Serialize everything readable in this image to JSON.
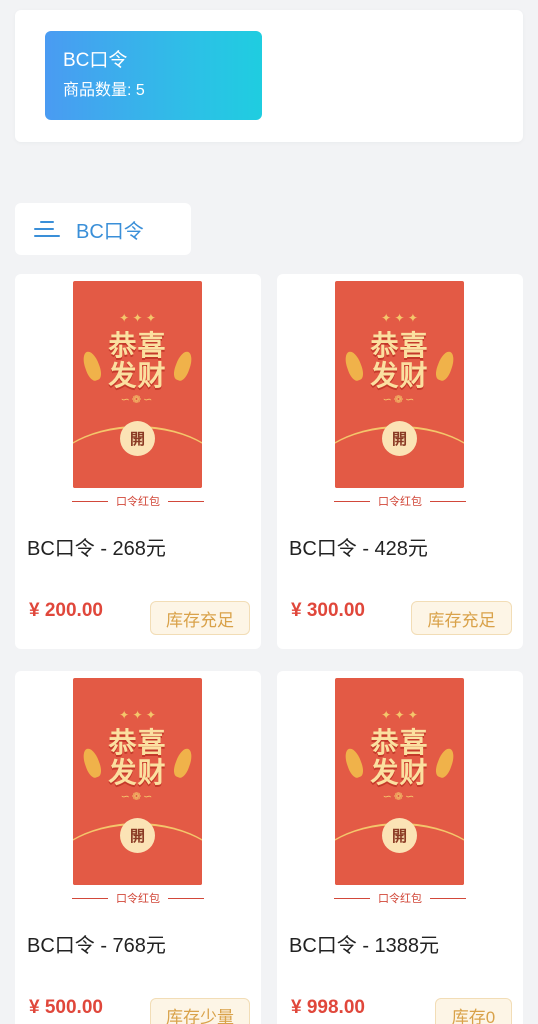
{
  "category": {
    "title": "BC口令",
    "count_text": "商品数量: 5"
  },
  "section": {
    "label": "BC口令"
  },
  "envelope": {
    "blessing_line1": "恭喜",
    "blessing_line2": "发财",
    "seal": "開",
    "caption": "口令红包"
  },
  "products": [
    {
      "name": "BC口令 - 268元",
      "price": "¥ 200.00",
      "stock": "库存充足"
    },
    {
      "name": "BC口令 - 428元",
      "price": "¥ 300.00",
      "stock": "库存充足"
    },
    {
      "name": "BC口令 - 768元",
      "price": "¥ 500.00",
      "stock": "库存少量"
    },
    {
      "name": "BC口令 - 1388元",
      "price": "¥ 998.00",
      "stock": "库存0"
    }
  ],
  "colors": {
    "accent": "#3a8fd8",
    "price": "#e0473b",
    "envelope": "#e35a45",
    "badge_text": "#d9a24a"
  }
}
